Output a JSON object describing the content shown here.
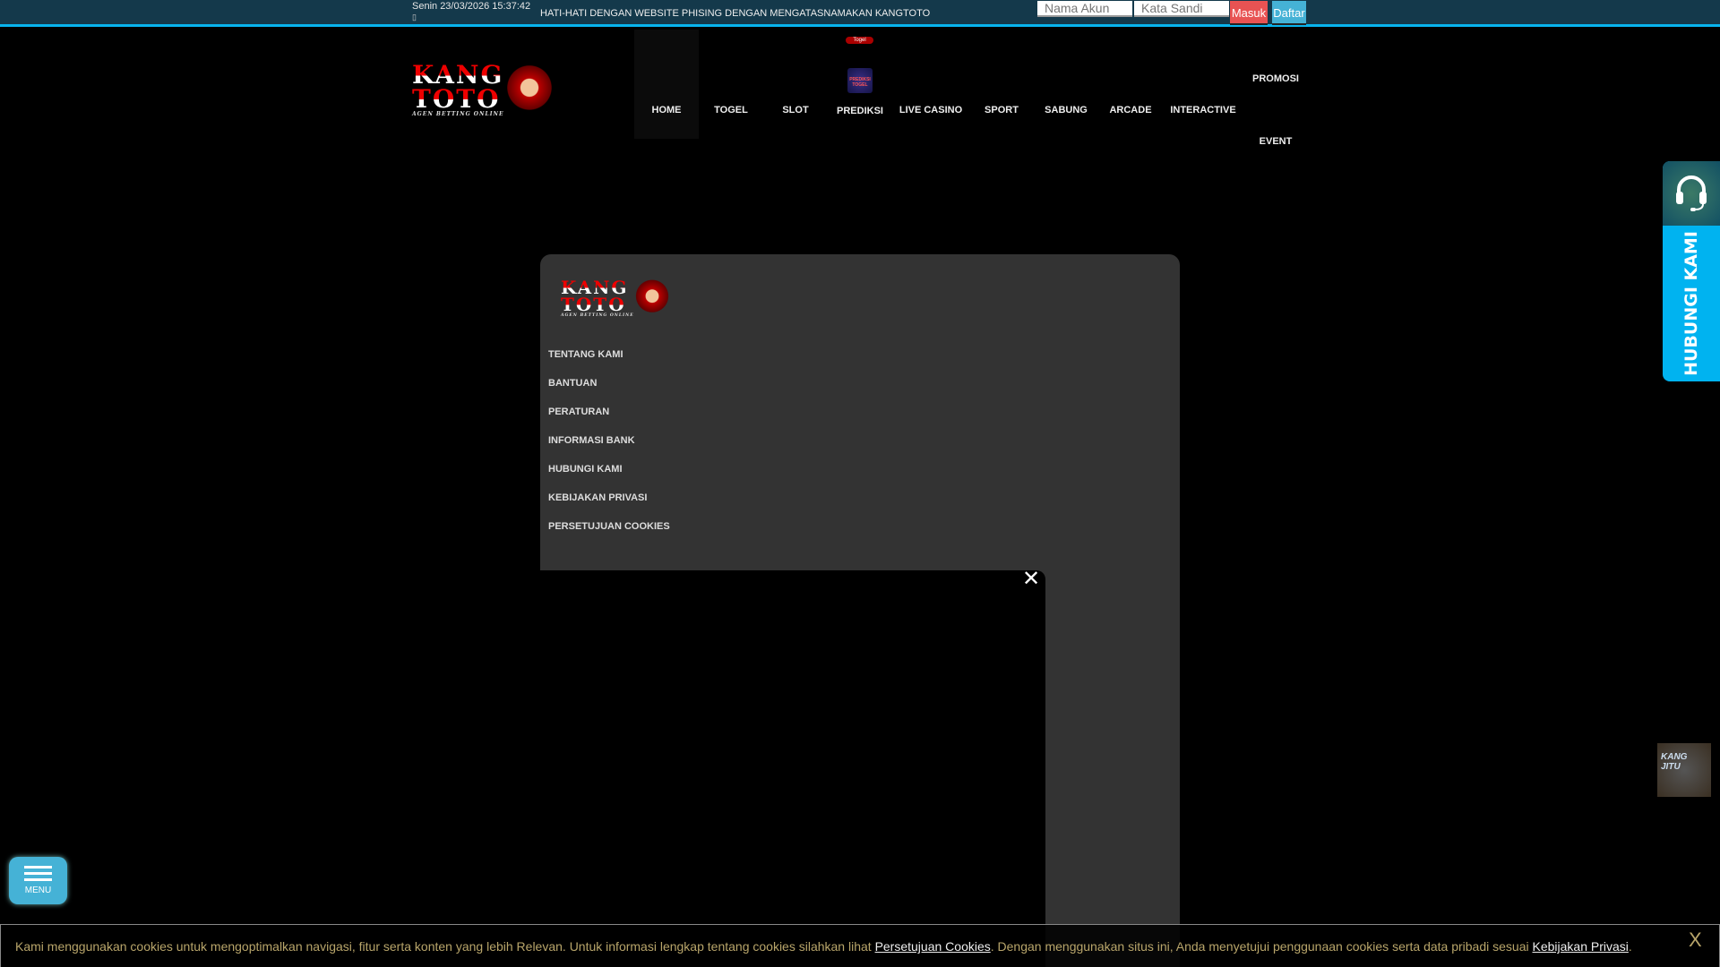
{
  "topbar": {
    "datetime": "Senin 23/03/2026 15:37:42",
    "icon_glyph": "▯",
    "warning": "HATI-HATI DENGAN WEBSITE PHISING DENGAN MENGATASNAMAKAN KANGTOTO",
    "username_placeholder": "Nama Akun",
    "password_placeholder": "Kata Sandi",
    "login_label": "Masuk",
    "register_label": "Daftar",
    "login_color": "#e85353",
    "register_color": "#45b2d6"
  },
  "logo": {
    "line1": "KANG",
    "line2": "TOTO",
    "tagline": "AGEN BETTING ONLINE"
  },
  "nav": {
    "items": [
      "HOME",
      "TOGEL",
      "SLOT",
      "PREDIKSI",
      "LIVE CASINO",
      "SPORT",
      "SABUNG",
      "ARCADE",
      "INTERACTIVE",
      "PROMOSI",
      "EVENT"
    ],
    "prediksi_badge": "Togel",
    "prediksi_icon_text": "PREDIKSI TOGEL"
  },
  "panel": {
    "menu": [
      "TENTANG KAMI",
      "BANTUAN",
      "PERATURAN",
      "INFORMASI BANK",
      "HUBUNGI KAMI",
      "KEBIJAKAN PRIVASI",
      "PERSETUJUAN COOKIES"
    ]
  },
  "video": {
    "close": "✕"
  },
  "contact": {
    "label": "HUBUNGI KAMI"
  },
  "jitu": {
    "text": "KANG JITU"
  },
  "menu_button": {
    "label": "MENU"
  },
  "cookie": {
    "text1": "Kami menggunakan cookies untuk mengoptimalkan navigasi, fitur serta konten yang lebih Relevan. Untuk informasi lengkap tentang cookies silahkan lihat ",
    "link1": "Persetujuan Cookies",
    "text2": ". Dengan menggunakan situs ini, Anda menyetujui penggunaan cookies serta data pribadi sesuai ",
    "link2": "Kebijakan Privasi",
    "text3": ".",
    "close": "X"
  }
}
